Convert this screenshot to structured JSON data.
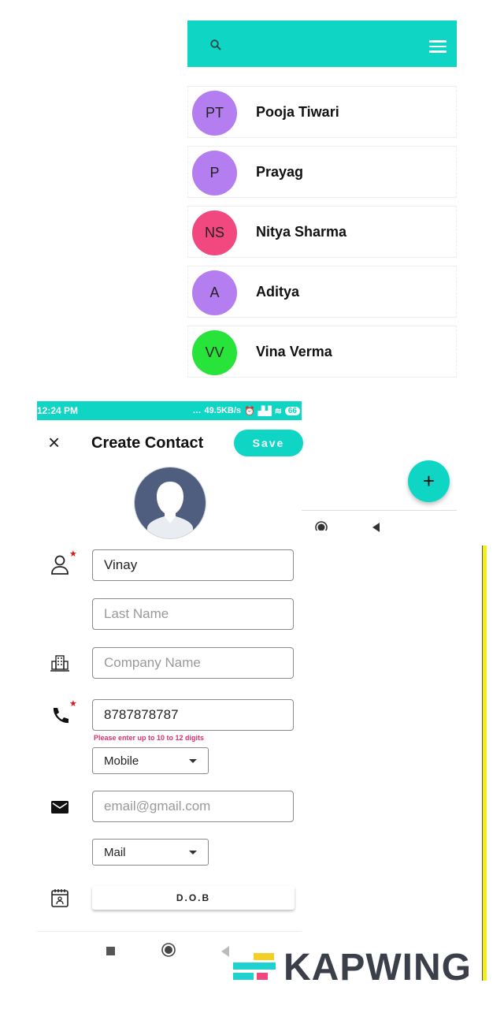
{
  "contacts_screen": {
    "toolbar": {
      "search_icon": "search-icon",
      "menu_icon": "hamburger-menu-icon",
      "color": "#0fd5c5"
    },
    "contacts": [
      {
        "initials": "PT",
        "name": "Pooja Tiwari",
        "color": "#b57ef0"
      },
      {
        "initials": "P",
        "name": "Prayag",
        "color": "#b57ef0"
      },
      {
        "initials": "NS",
        "name": "Nitya Sharma",
        "color": "#f0487f"
      },
      {
        "initials": "A",
        "name": "Aditya",
        "color": "#b57ef0"
      },
      {
        "initials": "VV",
        "name": "Vina Verma",
        "color": "#27e33a"
      }
    ],
    "fab_label": "+"
  },
  "create_contact": {
    "status_bar": {
      "time": "12:24 PM",
      "speed": "49.5KB/s",
      "battery": "66"
    },
    "title": "Create Contact",
    "save_label": "Save",
    "first_name": "Vinay",
    "last_name_placeholder": "Last Name",
    "company_placeholder": "Company Name",
    "phone": "8787878787",
    "phone_error": "Please enter up to 10 to 12 digits",
    "phone_type": "Mobile",
    "email_placeholder": "email@gmail.com",
    "email_type": "Mail",
    "dob_label": "D.O.B"
  },
  "watermark": {
    "text": "KAPWING"
  },
  "colors": {
    "accent": "#0fd5c5",
    "error": "#e0306a",
    "required": "#e01515"
  }
}
